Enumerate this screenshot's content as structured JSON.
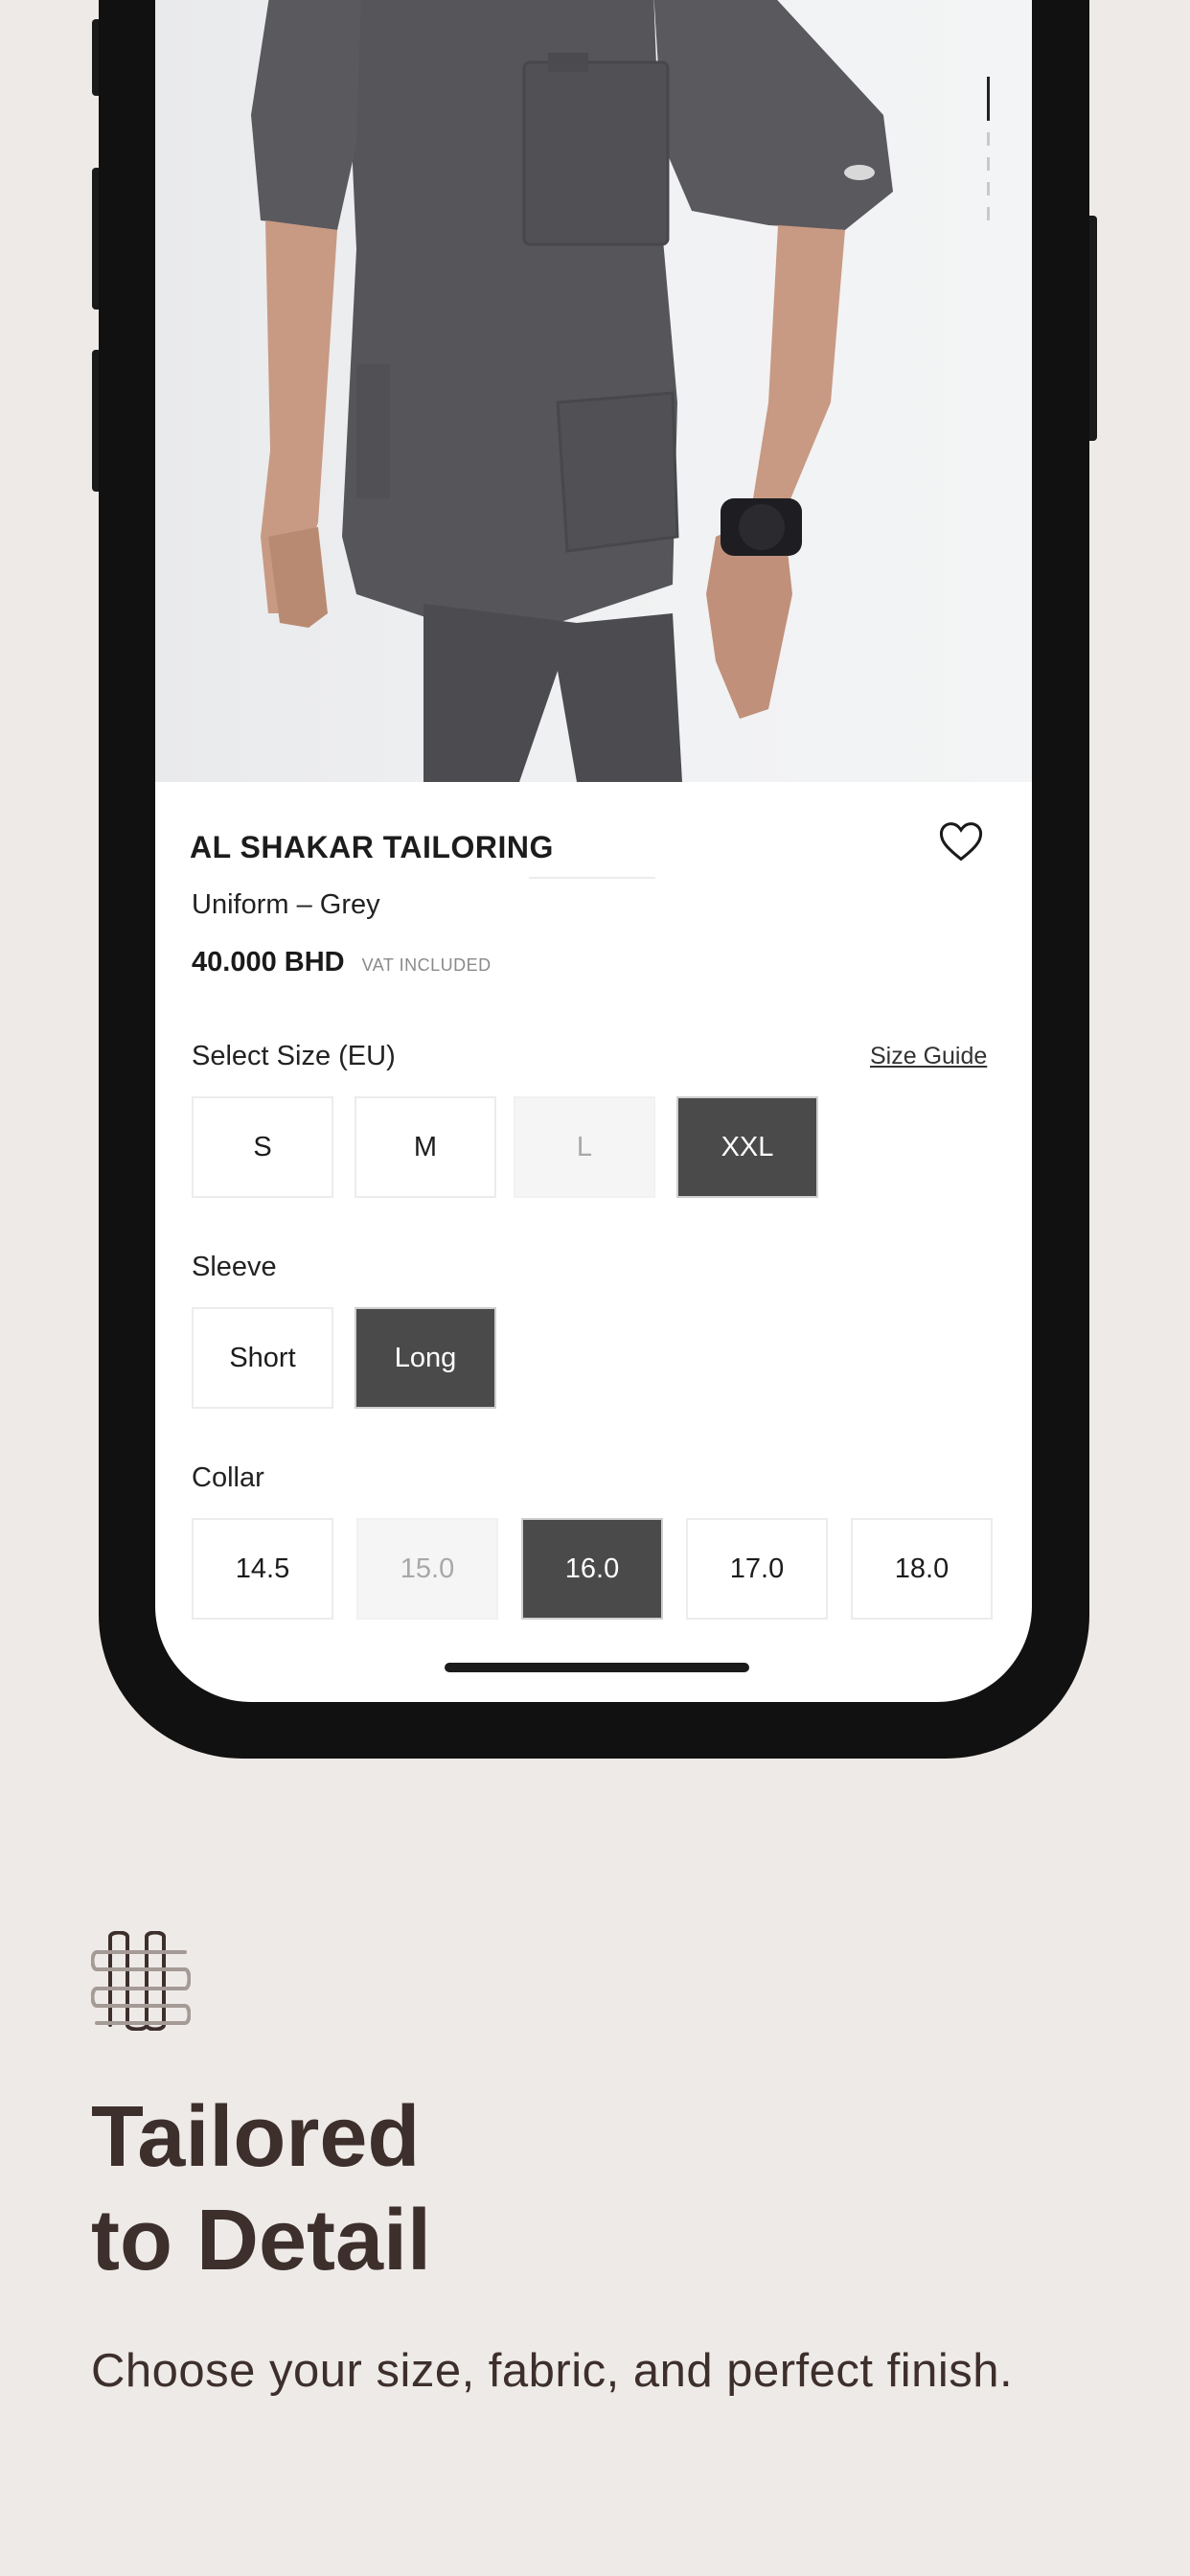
{
  "product": {
    "brand": "AL SHAKAR TAILORING",
    "name": "Uniform – Grey",
    "price": "40.000 BHD",
    "vat_note": "VAT INCLUDED"
  },
  "size": {
    "label": "Select Size (EU)",
    "guide_link": "Size Guide",
    "options": [
      "S",
      "M",
      "L",
      "XXL"
    ],
    "disabled": "L",
    "selected": "XXL"
  },
  "sleeve": {
    "label": "Sleeve",
    "options": [
      "Short",
      "Long"
    ],
    "selected": "Long"
  },
  "collar": {
    "label": "Collar",
    "options": [
      "14.5",
      "15.0",
      "16.0",
      "17.0",
      "18.0"
    ],
    "disabled": "15.0",
    "selected": "16.0"
  },
  "promo": {
    "headline_line1": "Tailored",
    "headline_line2": "to Detail",
    "subline": "Choose your size, fabric, and perfect finish."
  },
  "icons": {
    "favorite": "heart-icon",
    "logo": "weave-logo-icon"
  },
  "colors": {
    "background": "#eeeae7",
    "selected_option": "#4a4a4a",
    "headline_text": "#3d2f2b"
  }
}
